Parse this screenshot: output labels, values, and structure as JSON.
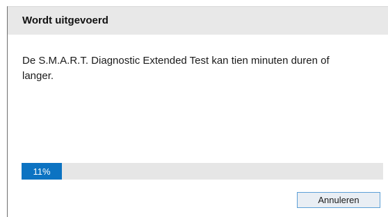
{
  "dialog": {
    "title": "Wordt uitgevoerd",
    "message": "De S.M.A.R.T. Diagnostic Extended Test kan tien minuten duren of langer.",
    "progress": {
      "percent": 11,
      "label": "11%"
    },
    "cancel_label": "Annuleren"
  }
}
